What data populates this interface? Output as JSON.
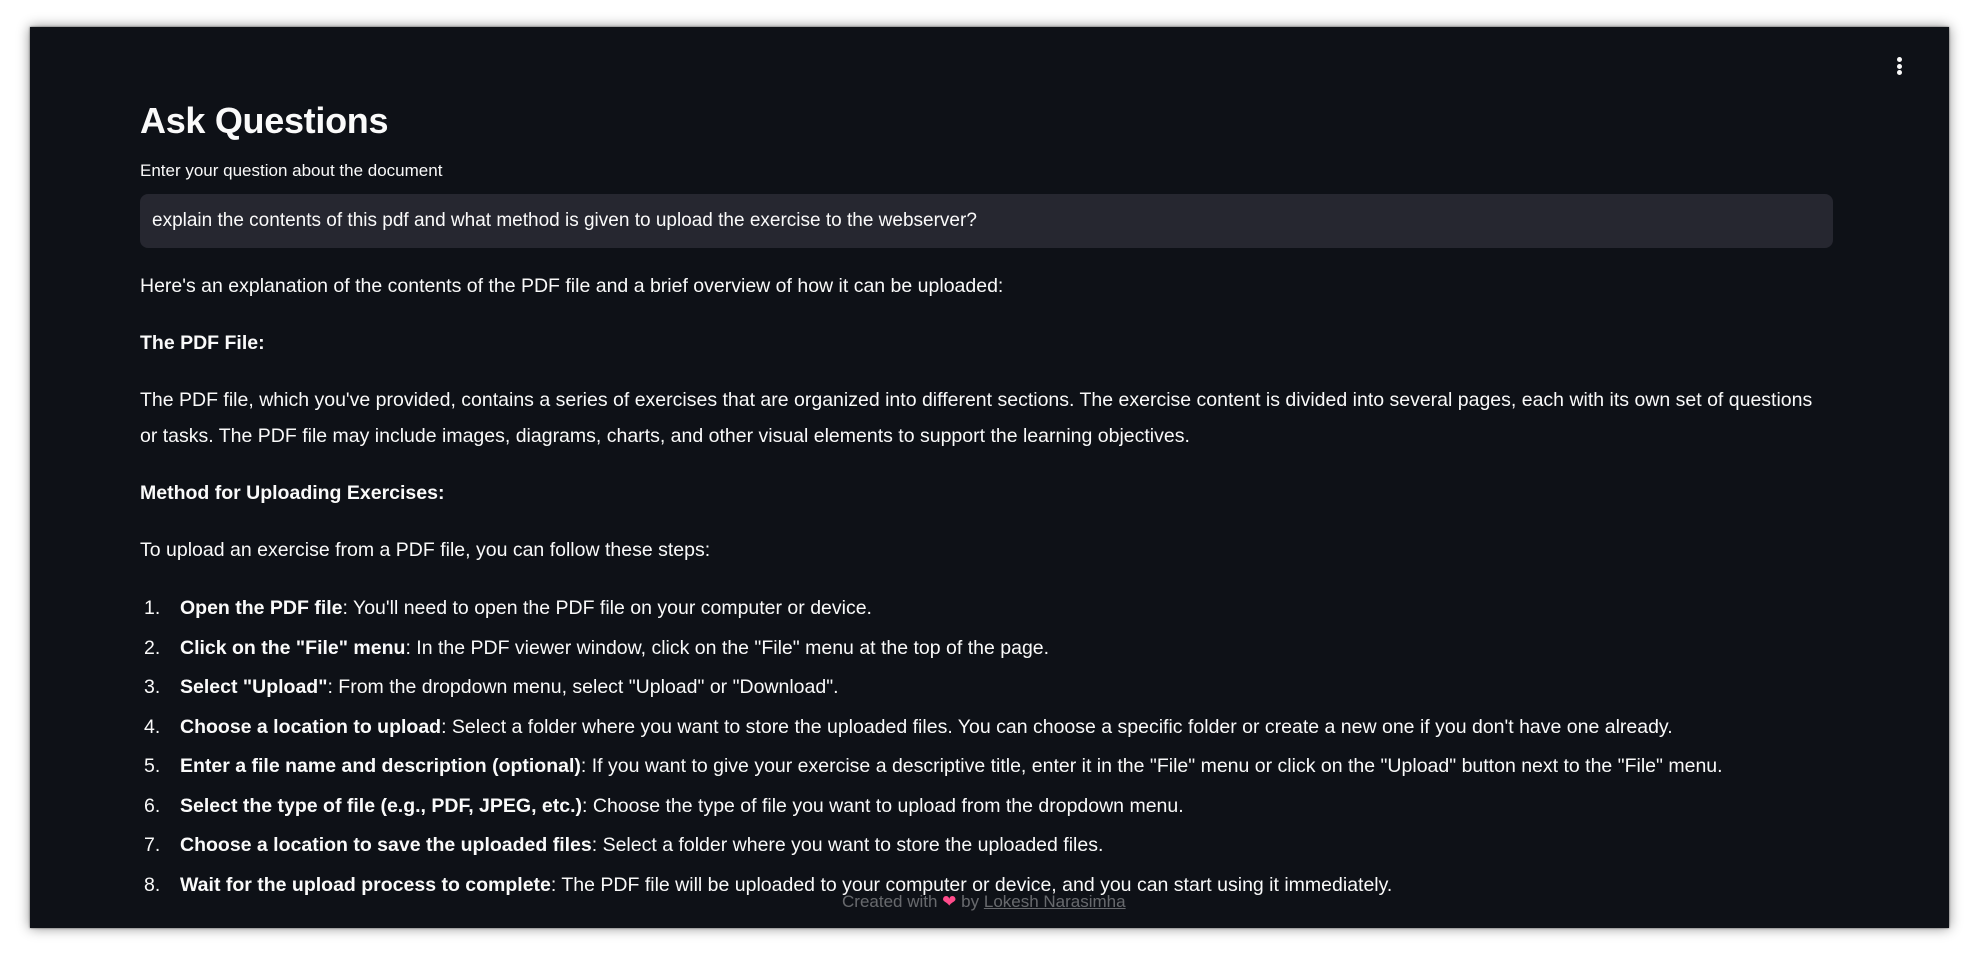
{
  "main": {
    "title": "Ask Questions",
    "input_label": "Enter your question about the document",
    "input_value": "explain the contents of this pdf and what method is given to upload the exercise to the webserver?"
  },
  "answer": {
    "intro": "Here's an explanation of the contents of the PDF file and a brief overview of how it can be uploaded:",
    "section1_heading": "The PDF File:",
    "section1_body": "The PDF file, which you've provided, contains a series of exercises that are organized into different sections. The exercise content is divided into several pages, each with its own set of questions or tasks. The PDF file may include images, diagrams, charts, and other visual elements to support the learning objectives.",
    "section2_heading": "Method for Uploading Exercises:",
    "section2_intro": "To upload an exercise from a PDF file, you can follow these steps:",
    "steps": [
      {
        "num": "1.",
        "bold": "Open the PDF file",
        "text": ": You'll need to open the PDF file on your computer or device."
      },
      {
        "num": "2.",
        "bold": "Click on the \"File\" menu",
        "text": ": In the PDF viewer window, click on the \"File\" menu at the top of the page."
      },
      {
        "num": "3.",
        "bold": "Select \"Upload\"",
        "text": ": From the dropdown menu, select \"Upload\" or \"Download\"."
      },
      {
        "num": "4.",
        "bold": "Choose a location to upload",
        "text": ": Select a folder where you want to store the uploaded files. You can choose a specific folder or create a new one if you don't have one already."
      },
      {
        "num": "5.",
        "bold": "Enter a file name and description (optional)",
        "text": ": If you want to give your exercise a descriptive title, enter it in the \"File\" menu or click on the \"Upload\" button next to the \"File\" menu."
      },
      {
        "num": "6.",
        "bold": "Select the type of file (e.g., PDF, JPEG, etc.)",
        "text": ": Choose the type of file you want to upload from the dropdown menu."
      },
      {
        "num": "7.",
        "bold": "Choose a location to save the uploaded files",
        "text": ": Select a folder where you want to store the uploaded files."
      },
      {
        "num": "8.",
        "bold": "Wait for the upload process to complete",
        "text": ": The PDF file will be uploaded to your computer or device, and you can start using it immediately."
      }
    ]
  },
  "footer": {
    "prefix": "Created with",
    "heart": "❤",
    "by": "by",
    "author": "Lokesh Narasimha"
  },
  "colors": {
    "background": "#0e1117",
    "input_background": "#262730",
    "text": "#fafafa",
    "heart": "#ff4b8b"
  },
  "icons": {
    "menu": "vertical-ellipsis-icon"
  }
}
